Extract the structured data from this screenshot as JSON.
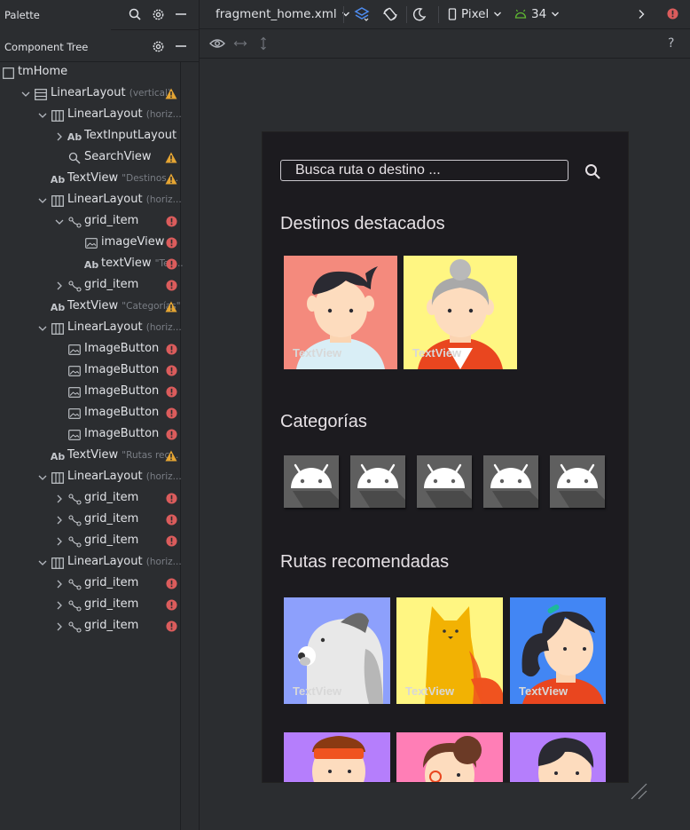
{
  "palette": {
    "title": "Palette"
  },
  "component_tree": {
    "title": "Component Tree",
    "rows": [
      {
        "label": "tmHome",
        "hint": "",
        "icon": "frame-icon",
        "status": ""
      },
      {
        "label": "LinearLayout",
        "hint": "(vertical)",
        "icon": "linear-vertical-icon",
        "status": "warning"
      },
      {
        "label": "LinearLayout",
        "hint": "(horiz...",
        "icon": "linear-horizontal-icon",
        "status": ""
      },
      {
        "label": "TextInputLayout",
        "hint": "",
        "icon": "text-icon",
        "status": ""
      },
      {
        "label": "SearchView",
        "hint": "",
        "icon": "search-icon",
        "status": "warning"
      },
      {
        "label": "TextView",
        "hint": "\"Destinos ...",
        "icon": "text-icon",
        "status": "warning"
      },
      {
        "label": "LinearLayout",
        "hint": "(horiz...",
        "icon": "linear-horizontal-icon",
        "status": ""
      },
      {
        "label": "grid_item",
        "hint": "",
        "icon": "include-icon",
        "status": "error"
      },
      {
        "label": "imageView",
        "hint": "",
        "icon": "image-icon",
        "status": "error"
      },
      {
        "label": "textView",
        "hint": "\"Tex...",
        "icon": "text-icon",
        "status": "error"
      },
      {
        "label": "grid_item",
        "hint": "",
        "icon": "include-icon",
        "status": "error"
      },
      {
        "label": "TextView",
        "hint": "\"Categorías\"",
        "icon": "text-icon",
        "status": "warning"
      },
      {
        "label": "LinearLayout",
        "hint": "(horiz...",
        "icon": "linear-horizontal-icon",
        "status": ""
      },
      {
        "label": "ImageButton",
        "hint": "",
        "icon": "image-icon",
        "status": "error"
      },
      {
        "label": "ImageButton",
        "hint": "",
        "icon": "image-icon",
        "status": "error"
      },
      {
        "label": "ImageButton",
        "hint": "",
        "icon": "image-icon",
        "status": "error"
      },
      {
        "label": "ImageButton",
        "hint": "",
        "icon": "image-icon",
        "status": "error"
      },
      {
        "label": "ImageButton",
        "hint": "",
        "icon": "image-icon",
        "status": "error"
      },
      {
        "label": "TextView",
        "hint": "\"Rutas rec...",
        "icon": "text-icon",
        "status": "warning"
      },
      {
        "label": "LinearLayout",
        "hint": "(horiz...",
        "icon": "linear-horizontal-icon",
        "status": ""
      },
      {
        "label": "grid_item",
        "hint": "",
        "icon": "include-icon",
        "status": "error"
      },
      {
        "label": "grid_item",
        "hint": "",
        "icon": "include-icon",
        "status": "error"
      },
      {
        "label": "grid_item",
        "hint": "",
        "icon": "include-icon",
        "status": "error"
      },
      {
        "label": "LinearLayout",
        "hint": "(horiz...",
        "icon": "linear-horizontal-icon",
        "status": ""
      },
      {
        "label": "grid_item",
        "hint": "",
        "icon": "include-icon",
        "status": "error"
      },
      {
        "label": "grid_item",
        "hint": "",
        "icon": "include-icon",
        "status": "error"
      },
      {
        "label": "grid_item",
        "hint": "",
        "icon": "include-icon",
        "status": "error"
      }
    ]
  },
  "toolbar": {
    "file_name": "fragment_home.xml",
    "device": "Pixel",
    "api_level": "34"
  },
  "preview": {
    "search_placeholder": "Busca ruta o destino ...",
    "section_destinos": "Destinos destacados",
    "section_categorias": "Categorías",
    "section_rutas": "Rutas recomendadas",
    "tile_label": "TextView"
  },
  "colors": {
    "warning": "#e5a533",
    "error": "#db5c5c",
    "accent": "#4e8cf0"
  }
}
